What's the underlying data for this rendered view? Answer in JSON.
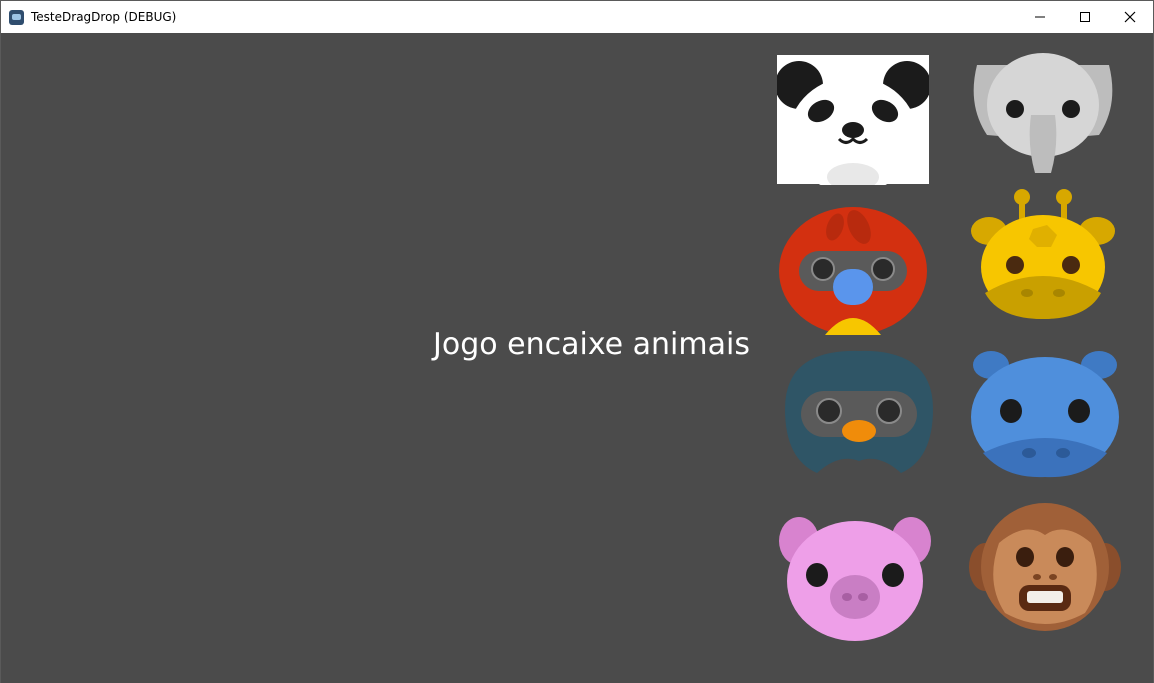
{
  "window": {
    "title": "TesteDragDrop (DEBUG)",
    "controls": [
      "minimize-icon",
      "maximize-icon",
      "close-icon"
    ]
  },
  "game": {
    "heading": "Jogo encaixe animais",
    "animals": [
      {
        "name": "panda",
        "color": "#ffffff"
      },
      {
        "name": "elephant",
        "color": "#c8c8c8"
      },
      {
        "name": "parrot",
        "color": "#cc3311"
      },
      {
        "name": "giraffe",
        "color": "#f5c400"
      },
      {
        "name": "penguin",
        "color": "#2f5566"
      },
      {
        "name": "hippo",
        "color": "#4f8fdc"
      },
      {
        "name": "pig",
        "color": "#ee9fe8"
      },
      {
        "name": "monkey",
        "color": "#a06038"
      }
    ]
  }
}
